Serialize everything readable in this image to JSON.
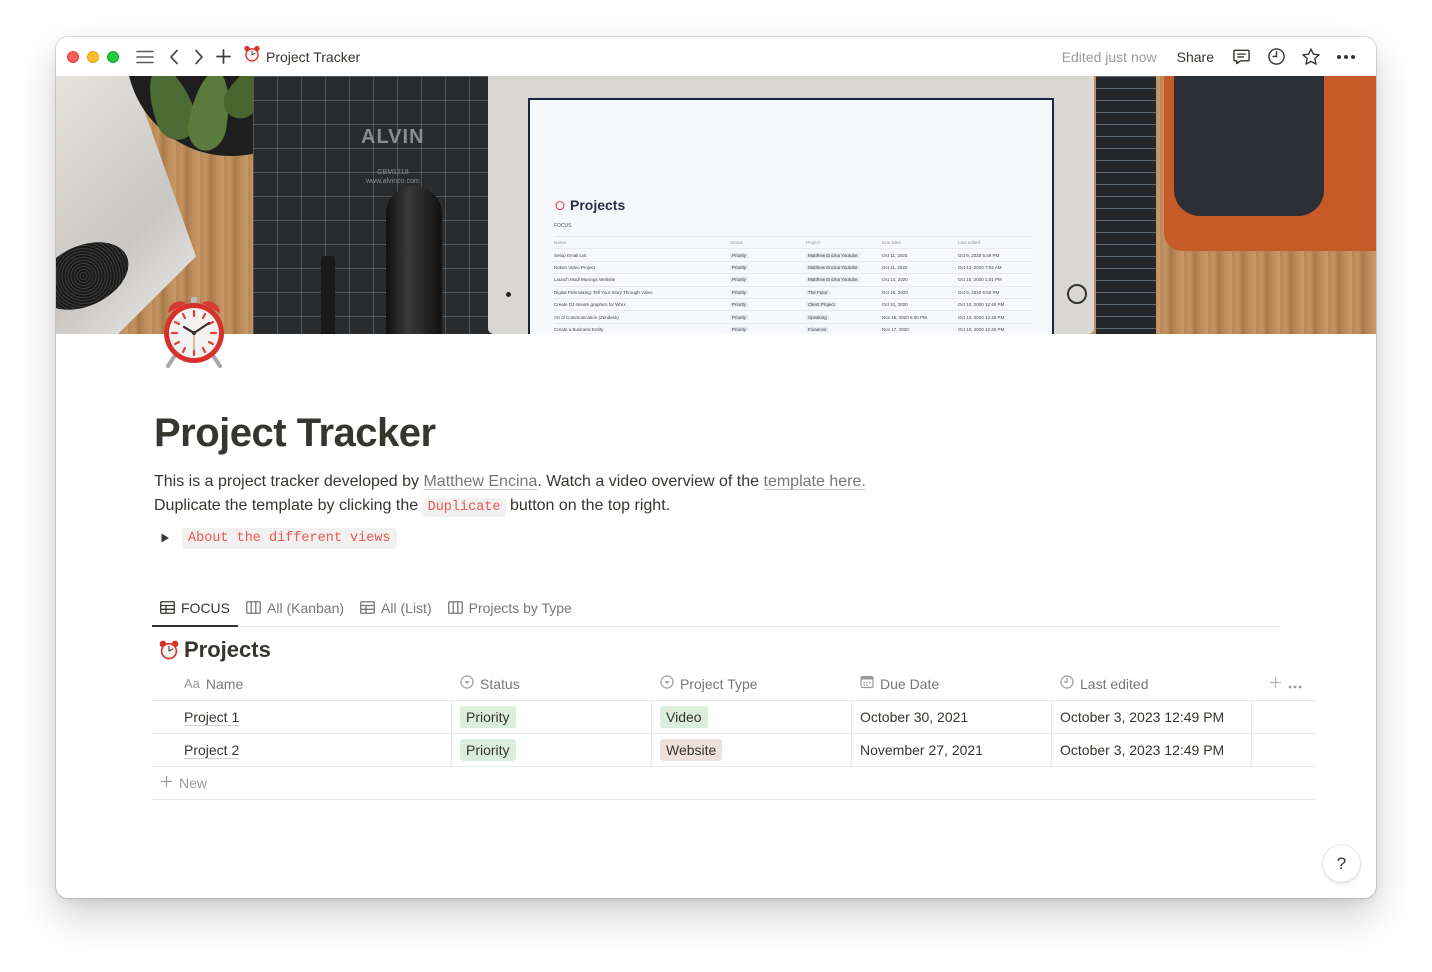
{
  "window": {
    "page_title": "Project Tracker",
    "page_icon": "alarm-clock-icon",
    "edited_status": "Edited just now",
    "share_label": "Share",
    "toolbar_icons": [
      "comments-icon",
      "history-clock-icon",
      "favorite-star-icon",
      "more-options-icon"
    ]
  },
  "cover": {
    "screen_title": "Projects",
    "screen_view": "FOCUS",
    "screen_headers": [
      "Name",
      "Status",
      "Project",
      "Due Date",
      "Last edited"
    ],
    "screen_rows": [
      [
        "Setup Email List",
        "Priority",
        "Matthew Encina Youtube",
        "Oct 11, 2020",
        "Oct 9, 2020 6:49 PM"
      ],
      [
        "Notion Video Project",
        "Priority",
        "Matthew Encina Youtube",
        "Oct 11, 2020",
        "Oct 13, 2020 7:54 AM"
      ],
      [
        "Launch Modi Musings Website",
        "Priority",
        "Matthew Encina Youtube",
        "Oct 14, 2020",
        "Oct 10, 2020 1:01 PM"
      ],
      [
        "Digital Filmmaking: Tell Your Story Through Video",
        "Priority",
        "The Futur",
        "Oct 16, 2020",
        "Oct 9, 2020 6:50 PM"
      ],
      [
        "Create DJ stream graphics for Wrex",
        "Priority",
        "Client Project",
        "Oct 31, 2020",
        "Oct 10, 2020 12:46 PM"
      ],
      [
        "Art of Communication (Zendesk)",
        "Priority",
        "Speaking",
        "Nov 16, 2020 6:00 PM",
        "Oct 12, 2020 12:48 PM"
      ],
      [
        "Create a Business Entity",
        "Priority",
        "Finances",
        "Nov 17, 2020",
        "Oct 10, 2020 12:46 PM"
      ]
    ],
    "mat_brand": "ALVIN",
    "mat_model": "GBM1218",
    "mat_url": "www.alvinco.com"
  },
  "page": {
    "title": "Project Tracker",
    "intro": {
      "text_before": "This is a project tracker developed by ",
      "author_link": "Matthew Encina",
      "text_middle": ". Watch a video overview of the ",
      "video_link": "template here.",
      "line2_before": "Duplicate the template by clicking the ",
      "duplicate_code": "Duplicate",
      "line2_after": " button on the top right."
    },
    "toggle_label": "About the different views"
  },
  "views": {
    "tabs": [
      {
        "label": "FOCUS",
        "icon": "table-icon",
        "active": true
      },
      {
        "label": "All (Kanban)",
        "icon": "board-icon",
        "active": false
      },
      {
        "label": "All (List)",
        "icon": "table-icon",
        "active": false
      },
      {
        "label": "Projects by Type",
        "icon": "board-icon",
        "active": false
      }
    ]
  },
  "database": {
    "title": "Projects",
    "columns": [
      {
        "label": "Name",
        "icon": "Aa"
      },
      {
        "label": "Status",
        "icon": "select-icon"
      },
      {
        "label": "Project Type",
        "icon": "select-icon"
      },
      {
        "label": "Due Date",
        "icon": "calendar-icon"
      },
      {
        "label": "Last edited",
        "icon": "clock-icon"
      }
    ],
    "rows": [
      {
        "name": "Project 1",
        "status": {
          "label": "Priority",
          "color": "#dbeddb"
        },
        "type": {
          "label": "Video",
          "color": "#dbeddb"
        },
        "due": "October 30, 2021",
        "edited": "October 3, 2023 12:49 PM"
      },
      {
        "name": "Project 2",
        "status": {
          "label": "Priority",
          "color": "#dbeddb"
        },
        "type": {
          "label": "Website",
          "color": "#eee0da"
        },
        "due": "November 27, 2021",
        "edited": "October 3, 2023 12:49 PM"
      }
    ],
    "new_label": "New"
  },
  "help_label": "?"
}
